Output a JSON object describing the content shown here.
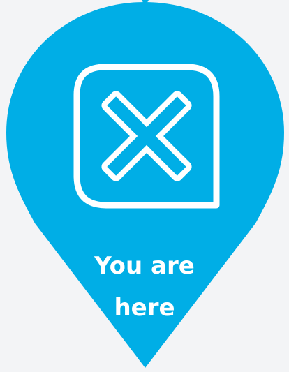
{
  "marker": {
    "color": "#00aee6",
    "icon": "x-mark-icon",
    "label_line1": "You are",
    "label_line2": "here"
  }
}
